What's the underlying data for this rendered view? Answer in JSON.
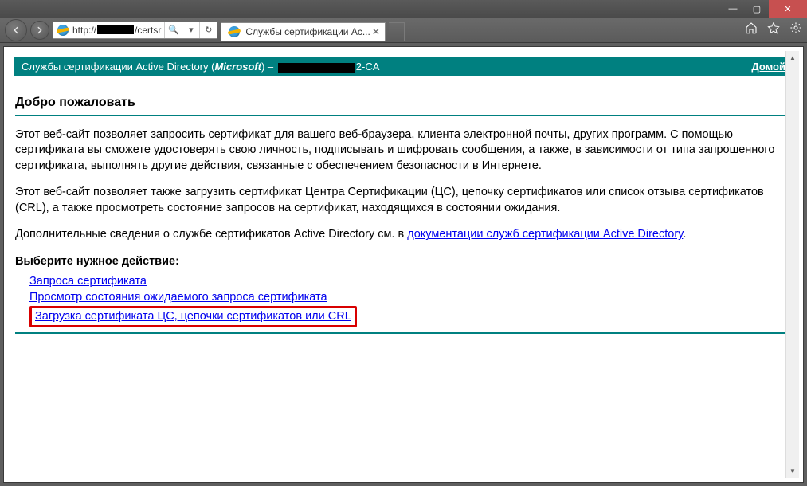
{
  "window": {
    "minimize": "—",
    "maximize": "▢",
    "close": "✕"
  },
  "nav": {
    "url_prefix": "http://",
    "url_suffix": "/certsr",
    "search_glyph": "🔍",
    "dropdown_glyph": "▾",
    "refresh_glyph": "↻"
  },
  "tab": {
    "title": "Службы сертификации Ас...",
    "close": "✕"
  },
  "toolbar": {
    "home": "home",
    "fav": "star",
    "tools": "gear"
  },
  "banner": {
    "text_prefix": "Службы сертификации Active Directory (",
    "text_company": "Microsoft",
    "text_middle": ")  –  ",
    "text_suffix": "2-CA",
    "home_link": "Домой"
  },
  "page": {
    "heading": "Добро пожаловать",
    "p1": "Этот веб-сайт позволяет запросить сертификат для вашего веб-браузера, клиента электронной почты, других программ. С помощью сертификата вы сможете удостоверять свою личность, подписывать и шифровать сообщения, а также, в зависимости от типа запрошенного сертификата, выполнять другие действия, связанные с обеспечением безопасности в Интернете.",
    "p2": "Этот веб-сайт позволяет также загрузить сертификат Центра Сертификации (ЦС), цепочку сертификатов или список отзыва сертификатов (CRL), а также просмотреть состояние запросов на сертификат, находящихся в состоянии ожидания.",
    "p3_prefix": "Дополнительные сведения о службе сертификатов Active Directory см. в ",
    "p3_link": "документации служб сертификации Active Directory",
    "p3_suffix": ".",
    "select_label": "Выберите нужное действие:",
    "actions": {
      "0": "Запроса сертификата",
      "1": "Просмотр состояния ожидаемого запроса сертификата",
      "2": "Загрузка сертификата ЦС, цепочки сертификатов или CRL"
    }
  }
}
